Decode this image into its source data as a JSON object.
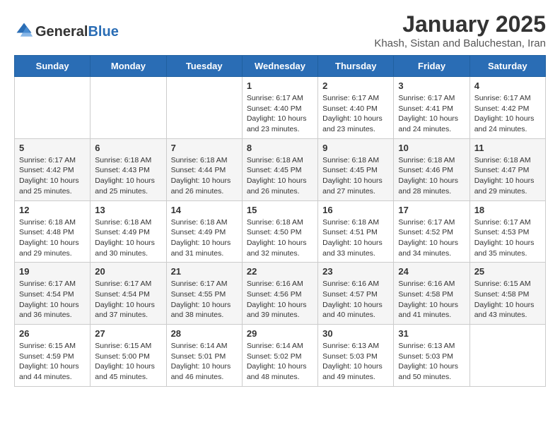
{
  "header": {
    "logo_general": "General",
    "logo_blue": "Blue",
    "month_year": "January 2025",
    "location": "Khash, Sistan and Baluchestan, Iran"
  },
  "weekdays": [
    "Sunday",
    "Monday",
    "Tuesday",
    "Wednesday",
    "Thursday",
    "Friday",
    "Saturday"
  ],
  "weeks": [
    [
      {
        "day": "",
        "info": ""
      },
      {
        "day": "",
        "info": ""
      },
      {
        "day": "",
        "info": ""
      },
      {
        "day": "1",
        "info": "Sunrise: 6:17 AM\nSunset: 4:40 PM\nDaylight: 10 hours\nand 23 minutes."
      },
      {
        "day": "2",
        "info": "Sunrise: 6:17 AM\nSunset: 4:40 PM\nDaylight: 10 hours\nand 23 minutes."
      },
      {
        "day": "3",
        "info": "Sunrise: 6:17 AM\nSunset: 4:41 PM\nDaylight: 10 hours\nand 24 minutes."
      },
      {
        "day": "4",
        "info": "Sunrise: 6:17 AM\nSunset: 4:42 PM\nDaylight: 10 hours\nand 24 minutes."
      }
    ],
    [
      {
        "day": "5",
        "info": "Sunrise: 6:17 AM\nSunset: 4:42 PM\nDaylight: 10 hours\nand 25 minutes."
      },
      {
        "day": "6",
        "info": "Sunrise: 6:18 AM\nSunset: 4:43 PM\nDaylight: 10 hours\nand 25 minutes."
      },
      {
        "day": "7",
        "info": "Sunrise: 6:18 AM\nSunset: 4:44 PM\nDaylight: 10 hours\nand 26 minutes."
      },
      {
        "day": "8",
        "info": "Sunrise: 6:18 AM\nSunset: 4:45 PM\nDaylight: 10 hours\nand 26 minutes."
      },
      {
        "day": "9",
        "info": "Sunrise: 6:18 AM\nSunset: 4:45 PM\nDaylight: 10 hours\nand 27 minutes."
      },
      {
        "day": "10",
        "info": "Sunrise: 6:18 AM\nSunset: 4:46 PM\nDaylight: 10 hours\nand 28 minutes."
      },
      {
        "day": "11",
        "info": "Sunrise: 6:18 AM\nSunset: 4:47 PM\nDaylight: 10 hours\nand 29 minutes."
      }
    ],
    [
      {
        "day": "12",
        "info": "Sunrise: 6:18 AM\nSunset: 4:48 PM\nDaylight: 10 hours\nand 29 minutes."
      },
      {
        "day": "13",
        "info": "Sunrise: 6:18 AM\nSunset: 4:49 PM\nDaylight: 10 hours\nand 30 minutes."
      },
      {
        "day": "14",
        "info": "Sunrise: 6:18 AM\nSunset: 4:49 PM\nDaylight: 10 hours\nand 31 minutes."
      },
      {
        "day": "15",
        "info": "Sunrise: 6:18 AM\nSunset: 4:50 PM\nDaylight: 10 hours\nand 32 minutes."
      },
      {
        "day": "16",
        "info": "Sunrise: 6:18 AM\nSunset: 4:51 PM\nDaylight: 10 hours\nand 33 minutes."
      },
      {
        "day": "17",
        "info": "Sunrise: 6:17 AM\nSunset: 4:52 PM\nDaylight: 10 hours\nand 34 minutes."
      },
      {
        "day": "18",
        "info": "Sunrise: 6:17 AM\nSunset: 4:53 PM\nDaylight: 10 hours\nand 35 minutes."
      }
    ],
    [
      {
        "day": "19",
        "info": "Sunrise: 6:17 AM\nSunset: 4:54 PM\nDaylight: 10 hours\nand 36 minutes."
      },
      {
        "day": "20",
        "info": "Sunrise: 6:17 AM\nSunset: 4:54 PM\nDaylight: 10 hours\nand 37 minutes."
      },
      {
        "day": "21",
        "info": "Sunrise: 6:17 AM\nSunset: 4:55 PM\nDaylight: 10 hours\nand 38 minutes."
      },
      {
        "day": "22",
        "info": "Sunrise: 6:16 AM\nSunset: 4:56 PM\nDaylight: 10 hours\nand 39 minutes."
      },
      {
        "day": "23",
        "info": "Sunrise: 6:16 AM\nSunset: 4:57 PM\nDaylight: 10 hours\nand 40 minutes."
      },
      {
        "day": "24",
        "info": "Sunrise: 6:16 AM\nSunset: 4:58 PM\nDaylight: 10 hours\nand 41 minutes."
      },
      {
        "day": "25",
        "info": "Sunrise: 6:15 AM\nSunset: 4:58 PM\nDaylight: 10 hours\nand 43 minutes."
      }
    ],
    [
      {
        "day": "26",
        "info": "Sunrise: 6:15 AM\nSunset: 4:59 PM\nDaylight: 10 hours\nand 44 minutes."
      },
      {
        "day": "27",
        "info": "Sunrise: 6:15 AM\nSunset: 5:00 PM\nDaylight: 10 hours\nand 45 minutes."
      },
      {
        "day": "28",
        "info": "Sunrise: 6:14 AM\nSunset: 5:01 PM\nDaylight: 10 hours\nand 46 minutes."
      },
      {
        "day": "29",
        "info": "Sunrise: 6:14 AM\nSunset: 5:02 PM\nDaylight: 10 hours\nand 48 minutes."
      },
      {
        "day": "30",
        "info": "Sunrise: 6:13 AM\nSunset: 5:03 PM\nDaylight: 10 hours\nand 49 minutes."
      },
      {
        "day": "31",
        "info": "Sunrise: 6:13 AM\nSunset: 5:03 PM\nDaylight: 10 hours\nand 50 minutes."
      },
      {
        "day": "",
        "info": ""
      }
    ]
  ]
}
